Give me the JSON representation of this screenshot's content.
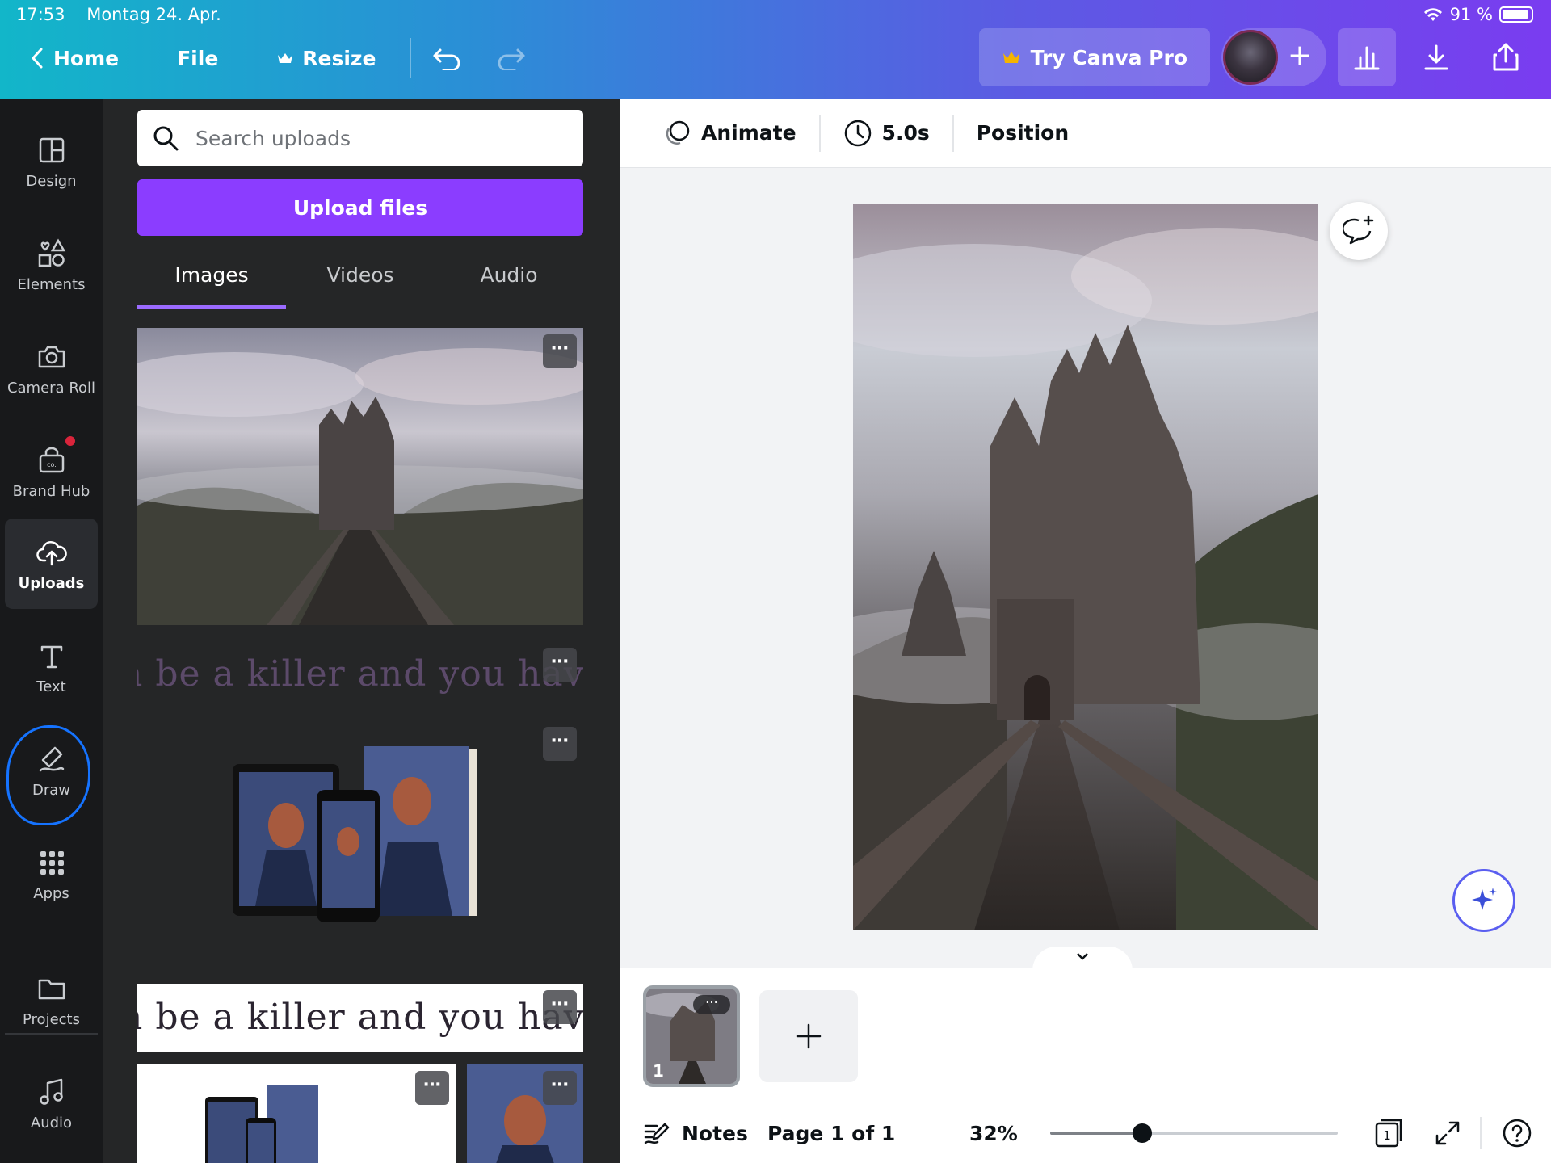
{
  "status_bar": {
    "time": "17:53",
    "date": "Montag 24. Apr.",
    "battery": "91 %"
  },
  "nav": {
    "home_label": "Home",
    "file_label": "File",
    "resize_label": "Resize"
  },
  "top_actions": {
    "try_pro_label": "Try Canva Pro"
  },
  "rail": {
    "design": "Design",
    "elements": "Elements",
    "camera_roll": "Camera Roll",
    "brand_hub": "Brand Hub",
    "uploads": "Uploads",
    "text": "Text",
    "draw": "Draw",
    "apps": "Apps",
    "projects": "Projects",
    "audio": "Audio"
  },
  "panel": {
    "search_placeholder": "Search uploads",
    "upload_button": "Upload files",
    "tabs": {
      "images": "Images",
      "videos": "Videos",
      "audio": "Audio"
    },
    "quote_text": "n be a killer and you have",
    "more_label": "⋯"
  },
  "context_bar": {
    "animate_label": "Animate",
    "duration_label": "5.0s",
    "position_label": "Position"
  },
  "pages": {
    "thumb_number": "1"
  },
  "footer": {
    "notes_label": "Notes",
    "page_label": "Page 1 of 1",
    "zoom_label": "32%",
    "zoom_value": 0.32,
    "pages_count": "1"
  },
  "colors": {
    "accent": "#8b3dff",
    "gradient_start": "#12b6c9",
    "gradient_end": "#7a3cf0",
    "annotation": "#1573ff"
  }
}
